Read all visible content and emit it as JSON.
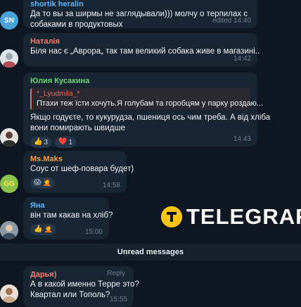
{
  "messages": [
    {
      "sender": "shortik heralin",
      "sender_color": "#5eb5f7",
      "avatar_initials": "SN",
      "avatar_color": "#4aa3d8",
      "lines": [
        "Да то вы за ширмы не заглядывали))) молчу о терпилах с",
        "собаками в продуктовых"
      ],
      "time": "edited 14:40"
    },
    {
      "sender": "Наталія",
      "sender_color": "#f47c6a",
      "avatar_icon": "photo-avatar",
      "lines": [
        "Біля нас є „Аврора„ так там великий собака живе в магазині.."
      ],
      "time": "14:42"
    },
    {
      "sender": "Юлия Кусакина",
      "sender_color": "#6fd279",
      "avatar_icon": "photo-avatar",
      "quote": {
        "name": "*_Lyudmila_*",
        "text": "Птахи теж їсти хочуть.Я голубам та горобцям у парку роздаю..."
      },
      "lines": [
        "Якщо годуєте, то кукурудза, пшениця ось чим треба. А від хліба",
        "вони помирають швидше"
      ],
      "reactions": [
        {
          "emoji": "👍",
          "icon": "thumbs-up-icon",
          "count": "3"
        },
        {
          "emoji": "❤️",
          "icon": "heart-icon",
          "count": "1"
        }
      ],
      "time": "14:43"
    },
    {
      "sender": "Ms.Maks",
      "sender_color": "#f0a04b",
      "avatar_initials": "GG",
      "avatar_color": "#8bc34a",
      "lines": [
        "Соус от шеф-повара будет)"
      ],
      "reactions": [
        {
          "emoji": "😱",
          "icon": "scream-icon"
        },
        {
          "emoji": "🤦",
          "icon": "facepalm-icon"
        }
      ],
      "time": "14:58"
    },
    {
      "sender": "Яна",
      "sender_color": "#5eb5f7",
      "avatar_icon": "photo-avatar",
      "lines": [
        "він там какав на хліб?"
      ],
      "reactions": [
        {
          "emoji": "👍",
          "icon": "thumbs-up-icon"
        },
        {
          "emoji": "🤦",
          "icon": "facepalm-icon"
        }
      ],
      "time": "15:00"
    },
    {
      "sender": "Дарья)",
      "sender_color": "#f47c6a",
      "avatar_icon": "photo-avatar",
      "reply_label": "Reply",
      "lines": [
        "А в какой именно Терре это?",
        "Квартал или Тополь?"
      ],
      "time": "15:55"
    }
  ],
  "unread_divider": "Unread messages",
  "watermark": {
    "text": "TELEGRAF",
    "icon": "telegraf-logo-icon",
    "color": "#f6c514"
  }
}
